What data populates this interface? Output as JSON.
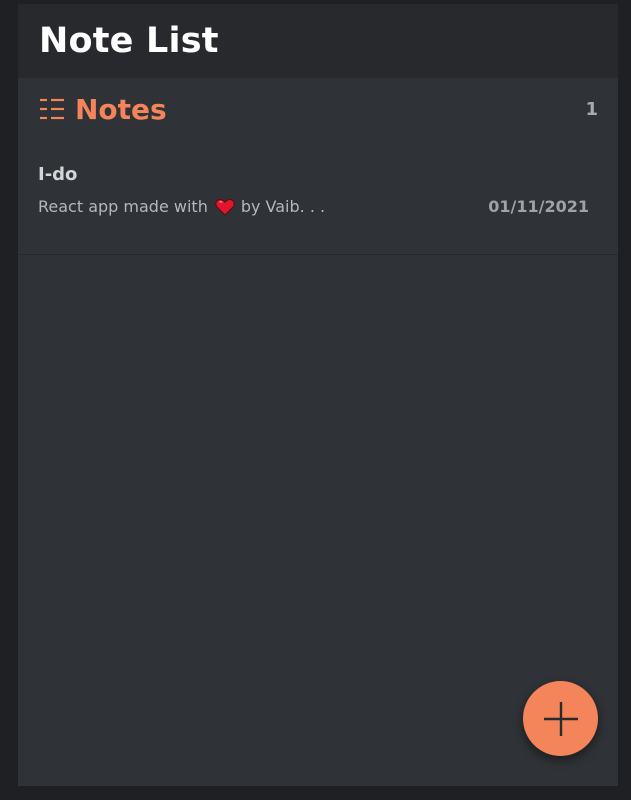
{
  "header": {
    "title": "Note List"
  },
  "notes_section": {
    "title": "Notes",
    "count": "1",
    "icon": "list-icon"
  },
  "notes": [
    {
      "title": "I-do",
      "preview_before": "React app made with",
      "preview_emoji": "heart-icon",
      "preview_after": "by Vaib. . .",
      "date": "01/11/2021"
    }
  ],
  "fab": {
    "icon": "plus-icon"
  },
  "colors": {
    "accent": "#f4845a",
    "background": "#2f3236",
    "titlebar": "#28292c",
    "outer": "#1f2023",
    "heart": "#e0162b"
  }
}
